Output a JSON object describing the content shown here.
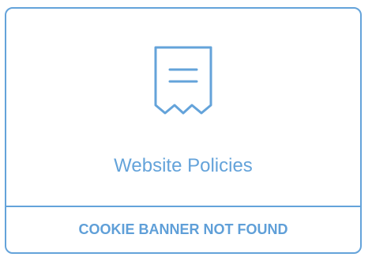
{
  "card": {
    "icon": "receipt-icon",
    "title": "Website Policies",
    "status_label": "COOKIE BANNER NOT FOUND"
  },
  "colors": {
    "accent": "#64a3da",
    "background": "#ffffff"
  }
}
